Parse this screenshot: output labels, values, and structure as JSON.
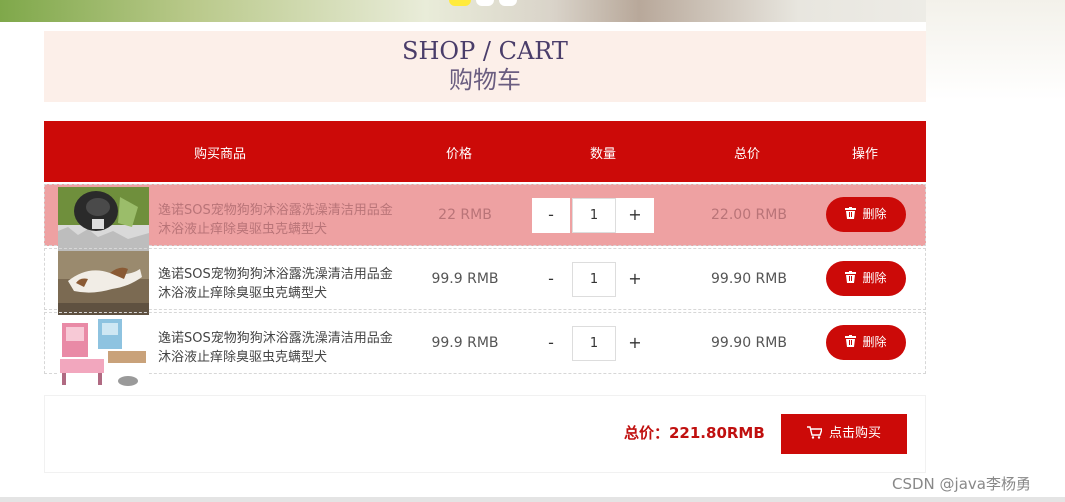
{
  "header": {
    "title_en": "SHOP / CART",
    "title_cn": "购物车"
  },
  "table": {
    "columns": [
      "购买商品",
      "价格",
      "数量",
      "总价",
      "操作"
    ],
    "rows": [
      {
        "name": "逸诺SOS宠物狗狗沐浴露洗澡清洁用品金沐浴液止痒除臭驱虫克螨型犬",
        "price": "22 RMB",
        "qty_minus": "-",
        "qty": "1",
        "qty_plus": "+",
        "total": "22.00 RMB",
        "delete_label": "删除",
        "highlighted": true
      },
      {
        "name": "逸诺SOS宠物狗狗沐浴露洗澡清洁用品金沐浴液止痒除臭驱虫克螨型犬",
        "price": "99.9 RMB",
        "qty_minus": "-",
        "qty": "1",
        "qty_plus": "+",
        "total": "99.90 RMB",
        "delete_label": "删除",
        "highlighted": false
      },
      {
        "name": "逸诺SOS宠物狗狗沐浴露洗澡清洁用品金沐浴液止痒除臭驱虫克螨型犬",
        "price": "99.9 RMB",
        "qty_minus": "-",
        "qty": "1",
        "qty_plus": "+",
        "total": "99.90 RMB",
        "delete_label": "删除",
        "highlighted": false
      }
    ]
  },
  "footer": {
    "total_text": "总价：221.80RMB",
    "buy_label": "点击购买"
  },
  "watermark": "CSDN @java李杨勇",
  "icons": {
    "delete": "trash-icon",
    "buy": "cart-icon"
  },
  "colors": {
    "accent": "#cc0a08",
    "title_bg": "#fcefe9",
    "row_highlight": "#eea1a2"
  }
}
